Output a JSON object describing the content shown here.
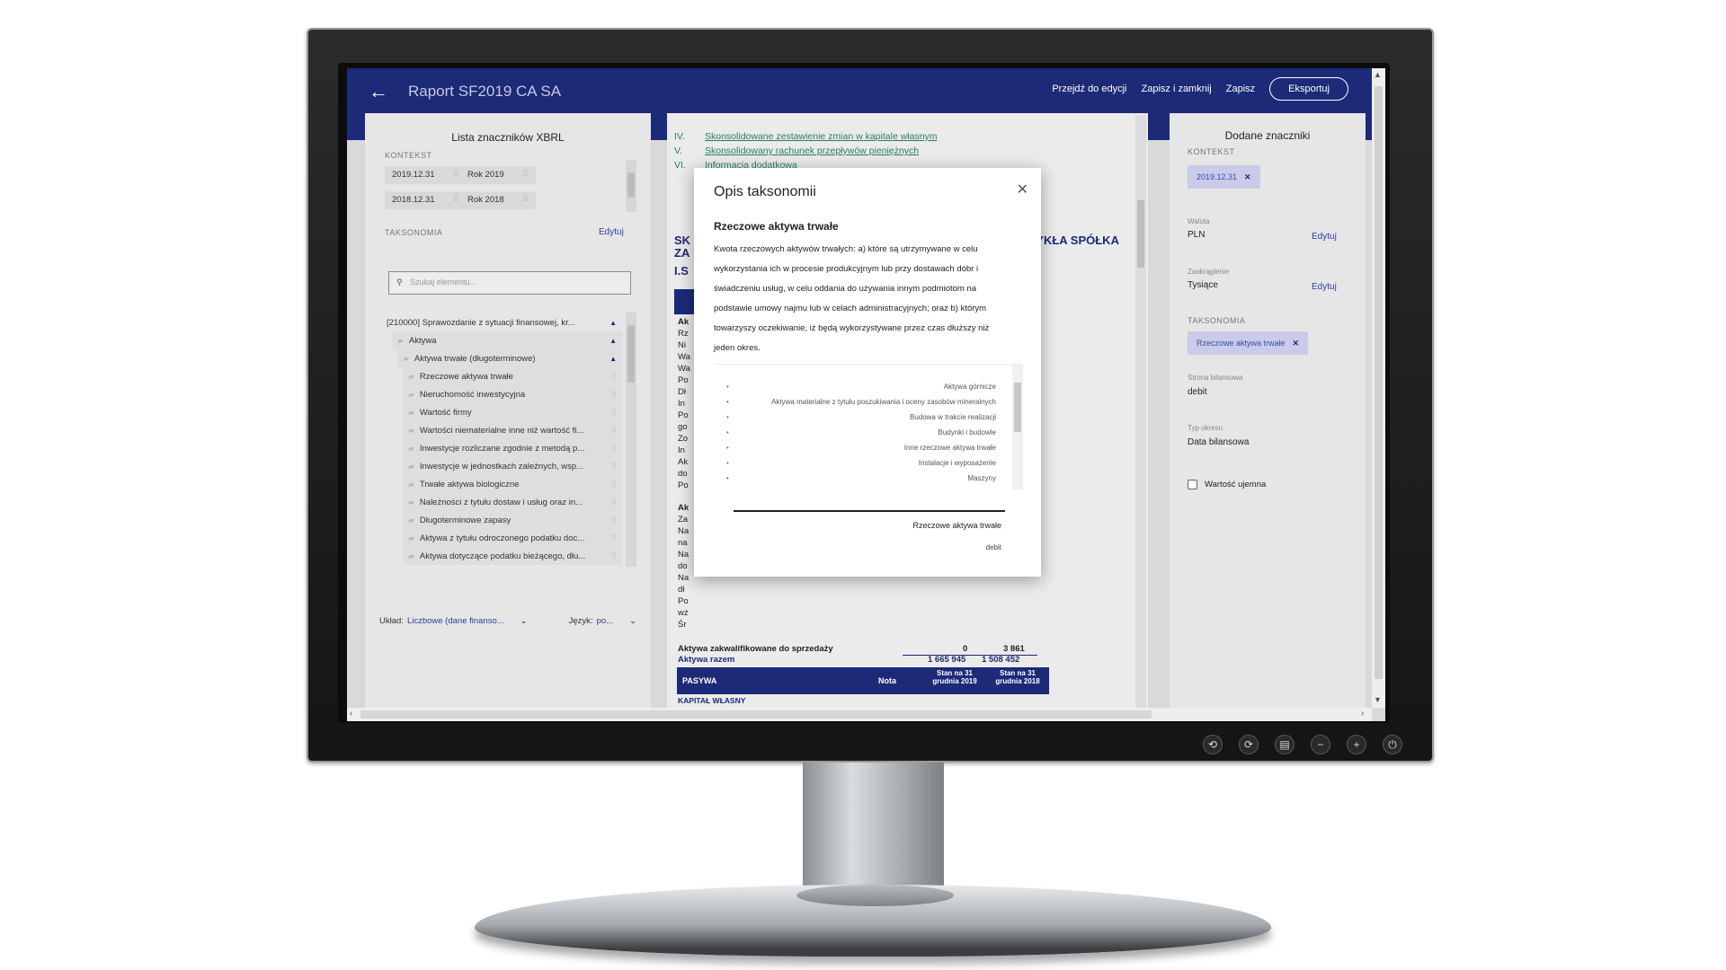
{
  "app": {
    "title": "Raport SF2019 CA SA",
    "actions": [
      "Przejdź do edycji",
      "Zapisz i zamknij",
      "Zapisz"
    ],
    "export_label": "Eksportuj"
  },
  "left": {
    "title": "Lista znaczników XBRL",
    "context_label": "KONTEKST",
    "contexts": [
      {
        "date": "2019.12.31",
        "period": "Rok 2019"
      },
      {
        "date": "2018.12.31",
        "period": "Rok 2018"
      }
    ],
    "taxonomy_label": "TAKSONOMIA",
    "edit_label": "Edytuj",
    "search_placeholder": "Szukaj elementu...",
    "tree": [
      "[210000] Sprawozdanie z sytuacji finansowej, kr...",
      "Aktywa",
      "Aktywa trwałe (długoterminowe)",
      "Rzeczowe aktywa trwałe",
      "Nieruchomość inwestycyjna",
      "Wartość firmy",
      "Wartości niematerialne inne niż wartość fi...",
      "Inwestycje rozliczane zgodnie z metodą p...",
      "Inwestycje w jednostkach zależnych, wsp...",
      "Trwałe aktywa biologiczne",
      "Należności z tytułu dostaw i usług oraz in...",
      "Długoterminowe zapasy",
      "Aktywa z tytułu odroczonego podatku doc...",
      "Aktywa dotyczące podatku bieżącego, dłu..."
    ],
    "layout_label": "Układ:",
    "layout_value": "Liczbowe (dane finanso...",
    "language_label": "Język:",
    "language_value": "po..."
  },
  "center": {
    "toc": [
      {
        "num": "IV.",
        "text": "Skonsolidowane zestawienie zmian w kapitale własnym"
      },
      {
        "num": "V.",
        "text": "Skonsolidowany rachunek przepływów pieniężnych"
      },
      {
        "num": "VI.",
        "text": "Informacja dodatkowa"
      }
    ],
    "heading_left": "SK",
    "heading_left2": "ZA",
    "heading_right": "WYKŁA SPÓŁKA",
    "section": "I.S",
    "rows_a": [
      "Ak",
      "Rz",
      "Ni",
      "Wa",
      "Wa",
      "Po",
      "Dł",
      "In",
      "Po",
      "go",
      "Zo",
      "In",
      "Ak",
      "do",
      "Po"
    ],
    "rows_b": [
      "Ak",
      "Za",
      "Na",
      "na",
      "Na",
      "do",
      "Na",
      "dł",
      "Po",
      "wż",
      "Śr"
    ],
    "held_for_sale": {
      "label": "Aktywa zakwalifikowane do sprzedaży",
      "v2019": "0",
      "v2018": "3 861"
    },
    "total_assets": {
      "label": "Aktywa razem",
      "v2019": "1 665 945",
      "v2018": "1 508 452"
    },
    "liabilities_header": {
      "label": "PASYWA",
      "note": "Nota",
      "col1": "Stan na 31 grudnia 2019",
      "col2": "Stan na 31 grudnia 2018"
    },
    "equity_label": "KAPITAŁ WŁASNY"
  },
  "modal": {
    "title": "Opis taksonomii",
    "subtitle": "Rzeczowe aktywa trwałe",
    "description": "Kwota rzeczowych aktywów trwałych: a) które są utrzymywane w celu wykorzystania ich w procesie produkcyjnym lub przy dostawach dóbr i świadczeniu usług, w celu oddania do używania innym podmiotom na podstawie umowy najmu lub w celach administracyjnych; oraz b) którym towarzyszy oczekiwanie, iż będą wykorzystywane przez czas dłuższy niż jeden okres.",
    "list": [
      "Aktywa górnicze",
      "Aktywa materialne z tytułu poszukiwania i oceny zasobów mineralnych",
      "Budowa w trakcie realizacji",
      "Budynki i budowle",
      "Inne rzeczowe aktywa trwałe",
      "Instalacje i wyposażenie",
      "Maszyny"
    ],
    "value_label": "Rzeczowe aktywa trwałe",
    "balance_side": "debit"
  },
  "right": {
    "title": "Dodane znaczniki",
    "context_label": "KONTEKST",
    "context_chip": "2019.12.31",
    "currency_label": "Waluta",
    "currency_value": "PLN",
    "rounding_label": "Zaokrąglenie",
    "rounding_value": "Tysiące",
    "edit_label": "Edytuj",
    "taxonomy_label": "TAKSONOMIA",
    "taxonomy_chip": "Rzeczowe aktywa trwałe",
    "balance_side_label": "Strona bilansowa",
    "balance_side_value": "debit",
    "period_type_label": "Typ okresu",
    "period_type_value": "Data bilansowa",
    "negative_label": "Wartość ujemna"
  }
}
